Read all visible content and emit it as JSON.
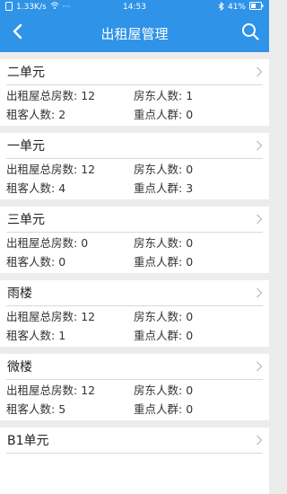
{
  "status": {
    "left_icon": "sim-icon",
    "speed": "1.33K/s",
    "wifi": "wifi-icon",
    "dots": "···",
    "time": "14:53",
    "bluetooth": "bluetooth-icon",
    "battery_percent": "41%",
    "battery_icon": "battery-icon"
  },
  "header": {
    "title": "出租屋管理",
    "back_icon": "chevron-left-icon",
    "search_icon": "search-icon"
  },
  "units": [
    {
      "name": "二单元",
      "total_label": "出租屋总房数:",
      "total": "12",
      "landlord_label": "房东人数:",
      "landlord": "1",
      "tenant_label": "租客人数:",
      "tenant": "2",
      "key_label": "重点人群:",
      "key": "0"
    },
    {
      "name": "一单元",
      "total_label": "出租屋总房数:",
      "total": "12",
      "landlord_label": "房东人数:",
      "landlord": "0",
      "tenant_label": "租客人数:",
      "tenant": "4",
      "key_label": "重点人群:",
      "key": "3"
    },
    {
      "name": "三单元",
      "total_label": "出租屋总房数:",
      "total": "0",
      "landlord_label": "房东人数:",
      "landlord": "0",
      "tenant_label": "租客人数:",
      "tenant": "0",
      "key_label": "重点人群:",
      "key": "0"
    },
    {
      "name": "雨楼",
      "total_label": "出租屋总房数:",
      "total": "12",
      "landlord_label": "房东人数:",
      "landlord": "0",
      "tenant_label": "租客人数:",
      "tenant": "1",
      "key_label": "重点人群:",
      "key": "0"
    },
    {
      "name": "微楼",
      "total_label": "出租屋总房数:",
      "total": "12",
      "landlord_label": "房东人数:",
      "landlord": "0",
      "tenant_label": "租客人数:",
      "tenant": "5",
      "key_label": "重点人群:",
      "key": "0"
    },
    {
      "name": "B1单元",
      "total_label": "",
      "total": "",
      "landlord_label": "",
      "landlord": "",
      "tenant_label": "",
      "tenant": "",
      "key_label": "",
      "key": ""
    }
  ],
  "colors": {
    "brand": "#2f93e8",
    "background": "#ececec",
    "divider": "#d9d9d9"
  }
}
